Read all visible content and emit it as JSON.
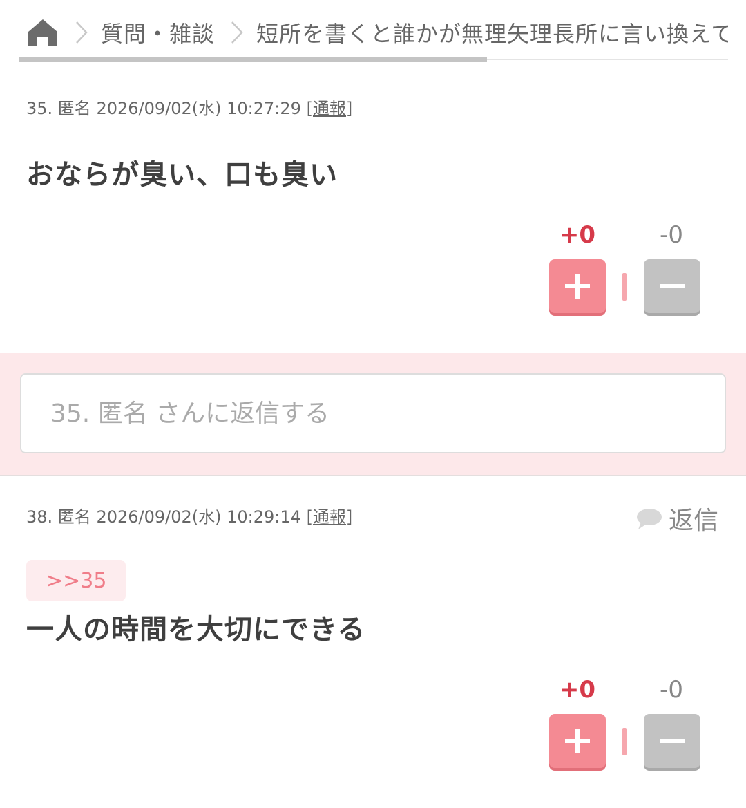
{
  "breadcrumb": {
    "home_icon": "home-icon",
    "category": "質問・雑談",
    "thread_title": "短所を書くと誰かが無理矢理長所に言い換えて"
  },
  "read_progress": 0.66,
  "colors": {
    "accent_pink": "#f48a93",
    "plus_count_red": "#d63a4a",
    "minus_gray": "#c2c2c2",
    "reply_band": "#fde8ea"
  },
  "comments": [
    {
      "number_name": "35. 匿名",
      "datetime": "2026/09/02(水) 10:27:29",
      "report_label": "[通報]",
      "body": "おならが臭い、口も臭い",
      "plus_count": "+0",
      "minus_count": "-0"
    },
    {
      "number_name": "38. 匿名",
      "datetime": "2026/09/02(水) 10:29:14",
      "report_label": "[通報]",
      "reply_label": "返信",
      "anchor": ">>35",
      "body": "一人の時間を大切にできる",
      "plus_count": "+0",
      "minus_count": "-0"
    }
  ],
  "reply_box": {
    "placeholder": "35. 匿名 さんに返信する"
  }
}
